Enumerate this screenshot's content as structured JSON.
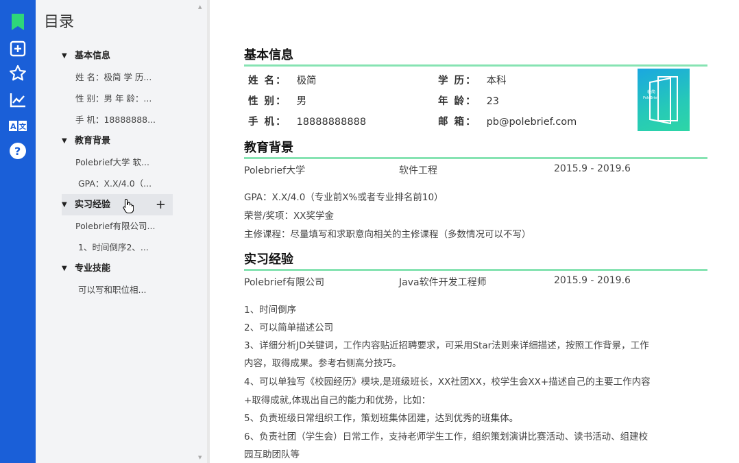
{
  "rail": {
    "icons": [
      "bookmark-icon",
      "add-box-icon",
      "star-icon",
      "chart-icon",
      "translate-icon",
      "help-icon"
    ]
  },
  "outline": {
    "title": "目录",
    "sections": [
      {
        "label": "基本信息",
        "children": [
          "姓 名：极简 学 历...",
          "性 别：男 年 龄：...",
          "手 机：18888888..."
        ]
      },
      {
        "label": "教育背景",
        "children": [
          "Polebrief大学 软...",
          "GPA：X.X/4.0（..."
        ]
      },
      {
        "label": "实习经验",
        "children": [
          "Polebrief有限公司...",
          "1、时间倒序2、..."
        ]
      },
      {
        "label": "专业技能",
        "children": [
          "可以写和职位相..."
        ]
      }
    ],
    "add_symbol": "+"
  },
  "resume": {
    "basic": {
      "title": "基本信息",
      "name_key": "姓 名：",
      "name_val": "极简",
      "edu_key": "学 历：",
      "edu_val": "本科",
      "gender_key": "性 别：",
      "gender_val": "男",
      "age_key": "年 龄：",
      "age_val": "23",
      "phone_key": "手 机：",
      "phone_val": "18888888888",
      "email_key": "邮 箱：",
      "email_val": "pb@polebrief.com",
      "photo_text1": "极简",
      "photo_text2": "PoleBrief"
    },
    "education": {
      "title": "教育背景",
      "school": "Polebrief大学",
      "major": "软件工程",
      "period": "2015.9 - 2019.6",
      "lines": [
        "GPA：X.X/4.0（专业前X%或者专业排名前10）",
        "荣誉/奖项：XX奖学金",
        "主修课程：尽量填写和求职意向相关的主修课程（多数情况可以不写）"
      ]
    },
    "internship": {
      "title": "实习经验",
      "company": "Polebrief有限公司",
      "role": "Java软件开发工程师",
      "period": "2015.9 - 2019.6",
      "lines": [
        "1、时间倒序",
        "2、可以简单描述公司",
        "3、详细分析JD关键词，工作内容贴近招聘要求，可采用Star法则来详细描述，按照工作背景，工作",
        "内容，取得成果。参考右侧高分技巧。",
        "4、可以单独写《校园经历》模块,是班级班长，XX社团XX，校学生会XX+描述自己的主要工作内容",
        "+取得成就,体现出自己的能力和优势，比如：",
        "5、负责班级日常组织工作，策划班集体团建，达到优秀的班集体。",
        "6、负责社团（学生会）日常工作，支持老师学生工作，组织策划演讲比赛活动、读书活动、组建校",
        "园互助团队等"
      ]
    }
  },
  "colors": {
    "rail": "#1a5fd8",
    "accent_line": "#86e3b2",
    "bookmark": "#2ed67a"
  }
}
